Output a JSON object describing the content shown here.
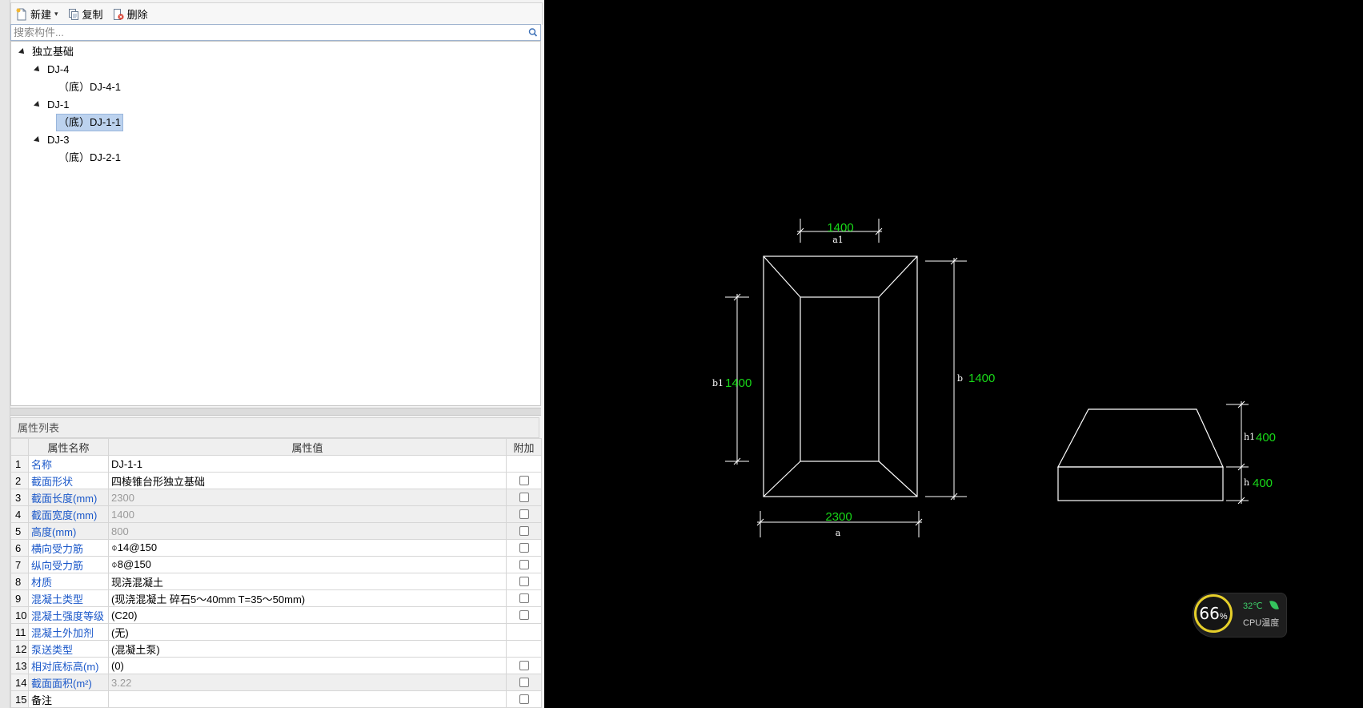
{
  "toolbar": {
    "new_label": "新建",
    "copy_label": "复制",
    "delete_label": "删除"
  },
  "search": {
    "placeholder": "搜索构件..."
  },
  "tree": {
    "root": "独立基础",
    "nodes": [
      {
        "label": "DJ-4",
        "child": "（底）DJ-4-1"
      },
      {
        "label": "DJ-1",
        "child": "（底）DJ-1-1"
      },
      {
        "label": "DJ-3",
        "child": "（底）DJ-2-1"
      }
    ],
    "selected": "（底）DJ-1-1"
  },
  "properties": {
    "title": "属性列表",
    "headers": {
      "name": "属性名称",
      "value": "属性值",
      "extra": "附加"
    },
    "rows": [
      {
        "no": "1",
        "name": "名称",
        "value": "DJ-1-1"
      },
      {
        "no": "2",
        "name": "截面形状",
        "value": "四棱锥台形独立基础"
      },
      {
        "no": "3",
        "name": "截面长度(mm)",
        "value": "2300"
      },
      {
        "no": "4",
        "name": "截面宽度(mm)",
        "value": "1400"
      },
      {
        "no": "5",
        "name": "高度(mm)",
        "value": "800"
      },
      {
        "no": "6",
        "name": "横向受力筋",
        "value": "⌽14@150"
      },
      {
        "no": "7",
        "name": "纵向受力筋",
        "value": "⌽8@150"
      },
      {
        "no": "8",
        "name": "材质",
        "value": "现浇混凝土"
      },
      {
        "no": "9",
        "name": "混凝土类型",
        "value": "(现浇混凝土    碎石5～40mm   T=35～50mm)"
      },
      {
        "no": "10",
        "name": "混凝土强度等级",
        "value": "(C20)"
      },
      {
        "no": "11",
        "name": "混凝土外加剂",
        "value": "(无)"
      },
      {
        "no": "12",
        "name": "泵送类型",
        "value": "(混凝土泵)"
      },
      {
        "no": "13",
        "name": "相对底标高(m)",
        "value": "(0)"
      },
      {
        "no": "14",
        "name": "截面面积(m²)",
        "value": "3.22"
      },
      {
        "no": "15",
        "name": "备注",
        "value": ""
      }
    ]
  },
  "drawing": {
    "a1_value": "1400",
    "a1_label": "a1",
    "a_value": "2300",
    "a_label": "a",
    "b1_label": "b1",
    "b1_value": "1400",
    "b_label": "b",
    "b_value": "1400",
    "h1_label": "h1",
    "h1_value": "400",
    "h_label": "h",
    "h_value": "400",
    "line_color": "#ffffff",
    "dim_color": "#18d818"
  },
  "cpu": {
    "percent": "66",
    "percent_sign": "%",
    "temp": "32℃",
    "label": "CPU温度",
    "ring_color": "#e6cf2a"
  }
}
